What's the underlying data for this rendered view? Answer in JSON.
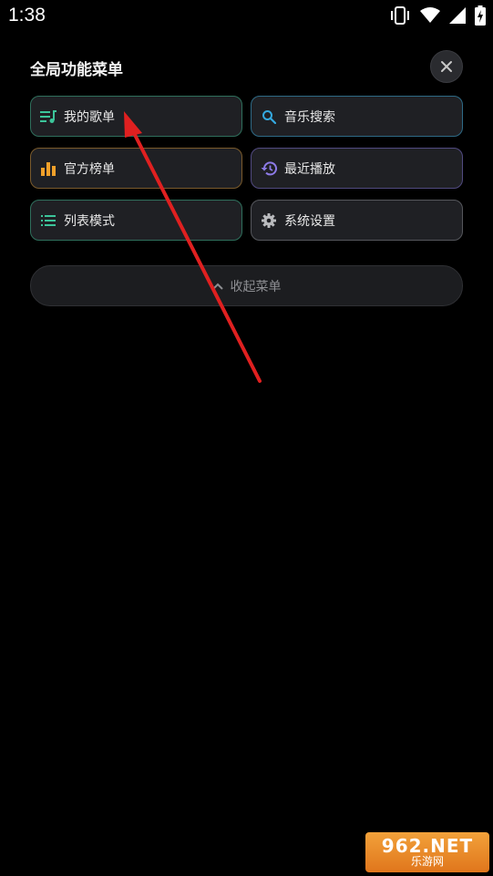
{
  "status_bar": {
    "time": "1:38",
    "icons": [
      "vibrate-icon",
      "wifi-icon",
      "signal-icon",
      "battery-charging-icon"
    ]
  },
  "panel": {
    "title": "全局功能菜单",
    "close_icon": "close-icon",
    "buttons": [
      {
        "label": "我的歌单",
        "icon": "playlist-icon",
        "border": "#2f6f5c",
        "icon_color": "#3cc59a"
      },
      {
        "label": "音乐搜索",
        "icon": "search-icon",
        "border": "#2e6a86",
        "icon_color": "#34a9e0"
      },
      {
        "label": "官方榜单",
        "icon": "bar-chart-icon",
        "border": "#7a5a2c",
        "icon_color": "#f0a02a"
      },
      {
        "label": "最近播放",
        "icon": "history-icon",
        "border": "#514a80",
        "icon_color": "#8c7ae6"
      },
      {
        "label": "列表模式",
        "icon": "list-icon",
        "border": "#2f6f5c",
        "icon_color": "#3cc59a"
      },
      {
        "label": "系统设置",
        "icon": "gear-icon",
        "border": "#55575c",
        "icon_color": "#b9babd"
      }
    ],
    "collapse": {
      "label": "收起菜单",
      "icon": "chevron-up-icon"
    }
  },
  "annotation": {
    "arrow_color": "#e02020"
  },
  "watermark": {
    "top": "962.NET",
    "bottom": "乐游网"
  }
}
